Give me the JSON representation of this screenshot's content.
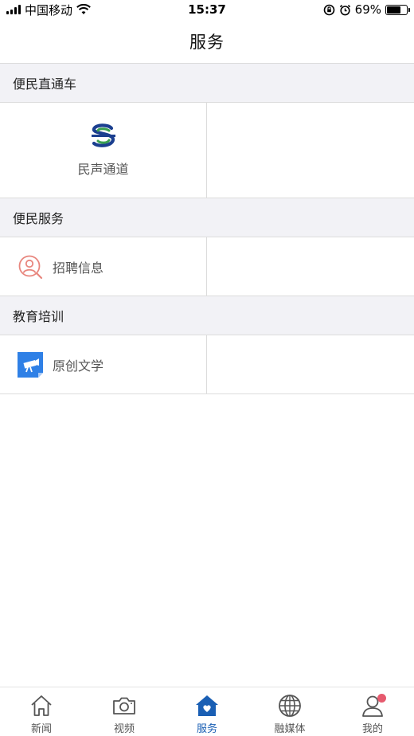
{
  "status_bar": {
    "carrier": "中国移动",
    "time": "15:37",
    "battery": "69%",
    "battery_level": 0.69
  },
  "header": {
    "title": "服务"
  },
  "sections": [
    {
      "title": "便民直通车",
      "items": [
        {
          "label": "民声通道",
          "icon": "minsheng-logo-icon"
        }
      ]
    },
    {
      "title": "便民服务",
      "items": [
        {
          "label": "招聘信息",
          "icon": "recruit-person-icon"
        }
      ]
    },
    {
      "title": "教育培训",
      "items": [
        {
          "label": "原创文学",
          "icon": "literature-camera-icon"
        }
      ]
    }
  ],
  "tab_bar": {
    "tabs": [
      {
        "label": "新闻",
        "icon": "home-icon"
      },
      {
        "label": "视频",
        "icon": "camera-icon"
      },
      {
        "label": "服务",
        "icon": "service-heart-home-icon",
        "active": true
      },
      {
        "label": "融媒体",
        "icon": "globe-icon"
      },
      {
        "label": "我的",
        "icon": "user-icon",
        "badge": true
      }
    ]
  },
  "colors": {
    "accent": "#1a5fb4",
    "section_bg": "#f2f2f6",
    "badge": "#e65a6e",
    "recruit_icon": "#e8867e",
    "literature_icon": "#2f80e6"
  }
}
